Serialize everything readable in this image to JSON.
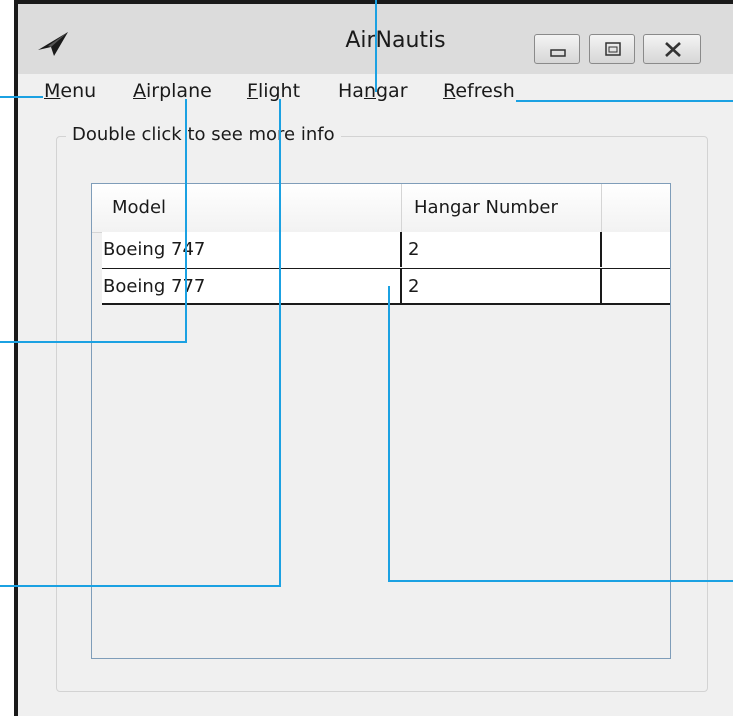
{
  "window": {
    "title": "AirNautis"
  },
  "menu": {
    "items": [
      {
        "mnemonic": "M",
        "rest": "enu"
      },
      {
        "mnemonic": "A",
        "rest": "irplane"
      },
      {
        "mnemonic": "F",
        "rest": "light"
      },
      {
        "prefix": "Ha",
        "mnemonic": "n",
        "rest": "gar"
      },
      {
        "mnemonic": "R",
        "rest": "efresh"
      }
    ]
  },
  "group": {
    "label": "Double click to see more info"
  },
  "grid": {
    "columns": [
      "Model",
      "Hangar Number"
    ],
    "rows": [
      {
        "model": "Boeing 747",
        "hangar": "2"
      },
      {
        "model": "Boeing 777",
        "hangar": "2"
      }
    ]
  },
  "icons": {
    "app": "paper-plane-icon",
    "minimize": "minimize-icon",
    "maximize": "maximize-icon",
    "close": "close-icon"
  },
  "colors": {
    "callout": "#1ba1e2",
    "grid_border": "#7f9db9",
    "window_bg": "#f0f0f0"
  }
}
